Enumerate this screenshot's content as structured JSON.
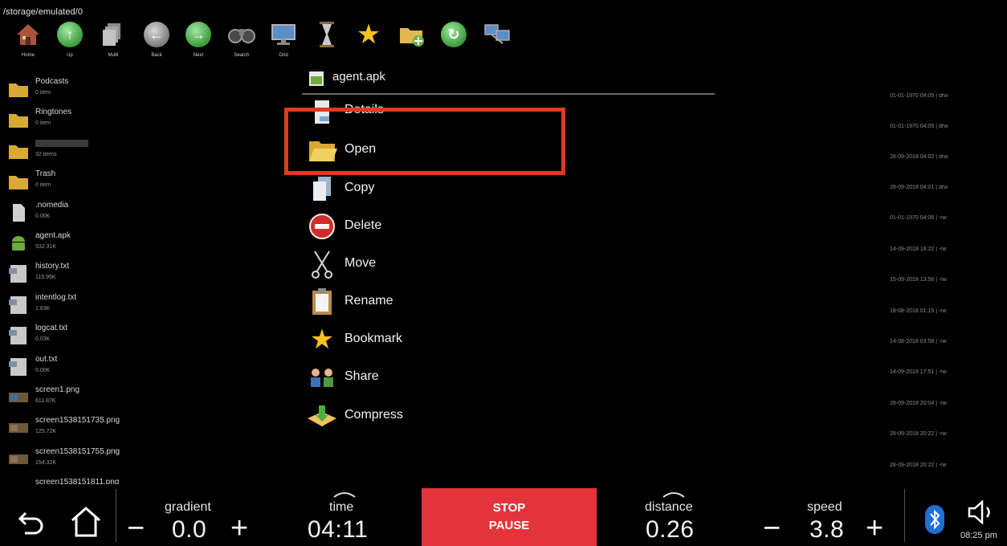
{
  "path": "/storage/emulated/0",
  "toolbar": [
    {
      "name": "home",
      "label": "Home",
      "icon": "house-icon"
    },
    {
      "name": "up",
      "label": "Up",
      "icon": "arrow-up-icon"
    },
    {
      "name": "multi",
      "label": "Multi",
      "icon": "stack-icon"
    },
    {
      "name": "back",
      "label": "Back",
      "icon": "arrow-left-icon"
    },
    {
      "name": "next",
      "label": "Next",
      "icon": "arrow-right-icon"
    },
    {
      "name": "search",
      "label": "Search",
      "icon": "binoculars-icon"
    },
    {
      "name": "grid",
      "label": "Grid",
      "icon": "monitor-icon"
    },
    {
      "name": "hourglass",
      "label": "",
      "icon": "hourglass-icon"
    },
    {
      "name": "bookmark",
      "label": "",
      "icon": "star-icon"
    },
    {
      "name": "new-folder",
      "label": "",
      "icon": "folder-add-icon"
    },
    {
      "name": "refresh",
      "label": "",
      "icon": "refresh-icon"
    },
    {
      "name": "network",
      "label": "",
      "icon": "network-icon"
    }
  ],
  "files": [
    {
      "name": "Podcasts",
      "size": "0 item",
      "type": "folder",
      "date": "01-01-1970 04:05 | drw"
    },
    {
      "name": "Ringtones",
      "size": "0 item",
      "type": "folder",
      "date": "01-01-1970 04:05 | drw"
    },
    {
      "name": "",
      "size": "32 items",
      "type": "folder",
      "date": "28-09-2018 04:02 | drw"
    },
    {
      "name": "Trash",
      "size": "0 item",
      "type": "folder",
      "date": "28-09-2018 04:01 | drw"
    },
    {
      "name": ".nomedia",
      "size": "0.00K",
      "type": "file",
      "date": "01-01-1970 04:06 | -rw"
    },
    {
      "name": "agent.apk",
      "size": "532.31K",
      "type": "apk",
      "date": "14-09-2018 18:22 | -rw"
    },
    {
      "name": "history.txt",
      "size": "115.95K",
      "type": "text",
      "date": "15-09-2018 13:56 | -rw"
    },
    {
      "name": "intentlog.txt",
      "size": "1.63K",
      "type": "text",
      "date": "18-08-2018 01:15 | -rw"
    },
    {
      "name": "logcat.txt",
      "size": "0.03K",
      "type": "text",
      "date": "14-08-2018 03:58 | -rw"
    },
    {
      "name": "out.txt",
      "size": "0.00K",
      "type": "text",
      "date": "14-09-2018 17:51 | -rw"
    },
    {
      "name": "screen1.png",
      "size": "611.87K",
      "type": "image",
      "date": "28-09-2018 20:04 | -rw"
    },
    {
      "name": "screen1538151735.png",
      "size": "125.72K",
      "type": "image",
      "date": "28-09-2018 20:22 | -rw"
    },
    {
      "name": "screen1538151755.png",
      "size": "154.32K",
      "type": "image",
      "date": "28-09-2018 20:22 | -rw"
    },
    {
      "name": "screen1538151811.png",
      "size": "",
      "type": "image",
      "date": ""
    }
  ],
  "context_menu": {
    "title": "agent.apk",
    "items": [
      {
        "label": "Details",
        "icon": "details-icon"
      },
      {
        "label": "Open",
        "icon": "folder-open-icon"
      },
      {
        "label": "Copy",
        "icon": "copy-icon"
      },
      {
        "label": "Delete",
        "icon": "delete-icon"
      },
      {
        "label": "Move",
        "icon": "scissors-icon"
      },
      {
        "label": "Rename",
        "icon": "clipboard-icon"
      },
      {
        "label": "Bookmark",
        "icon": "star-icon"
      },
      {
        "label": "Share",
        "icon": "share-icon"
      },
      {
        "label": "Compress",
        "icon": "compress-icon"
      }
    ]
  },
  "bottom_bar": {
    "gradient_label": "gradient",
    "gradient_value": "0.0",
    "time_label": "time",
    "time_value": "04:11",
    "stop_label": "STOP",
    "pause_label": "PAUSE",
    "distance_label": "distance",
    "distance_value": "0.26",
    "speed_label": "speed",
    "speed_value": "3.8",
    "minus": "−",
    "plus": "+",
    "clock": "08:25 pm"
  },
  "colors": {
    "highlight_border": "#e03a20",
    "stop_button": "#e3343b",
    "bluetooth": "#1f6fd6"
  }
}
